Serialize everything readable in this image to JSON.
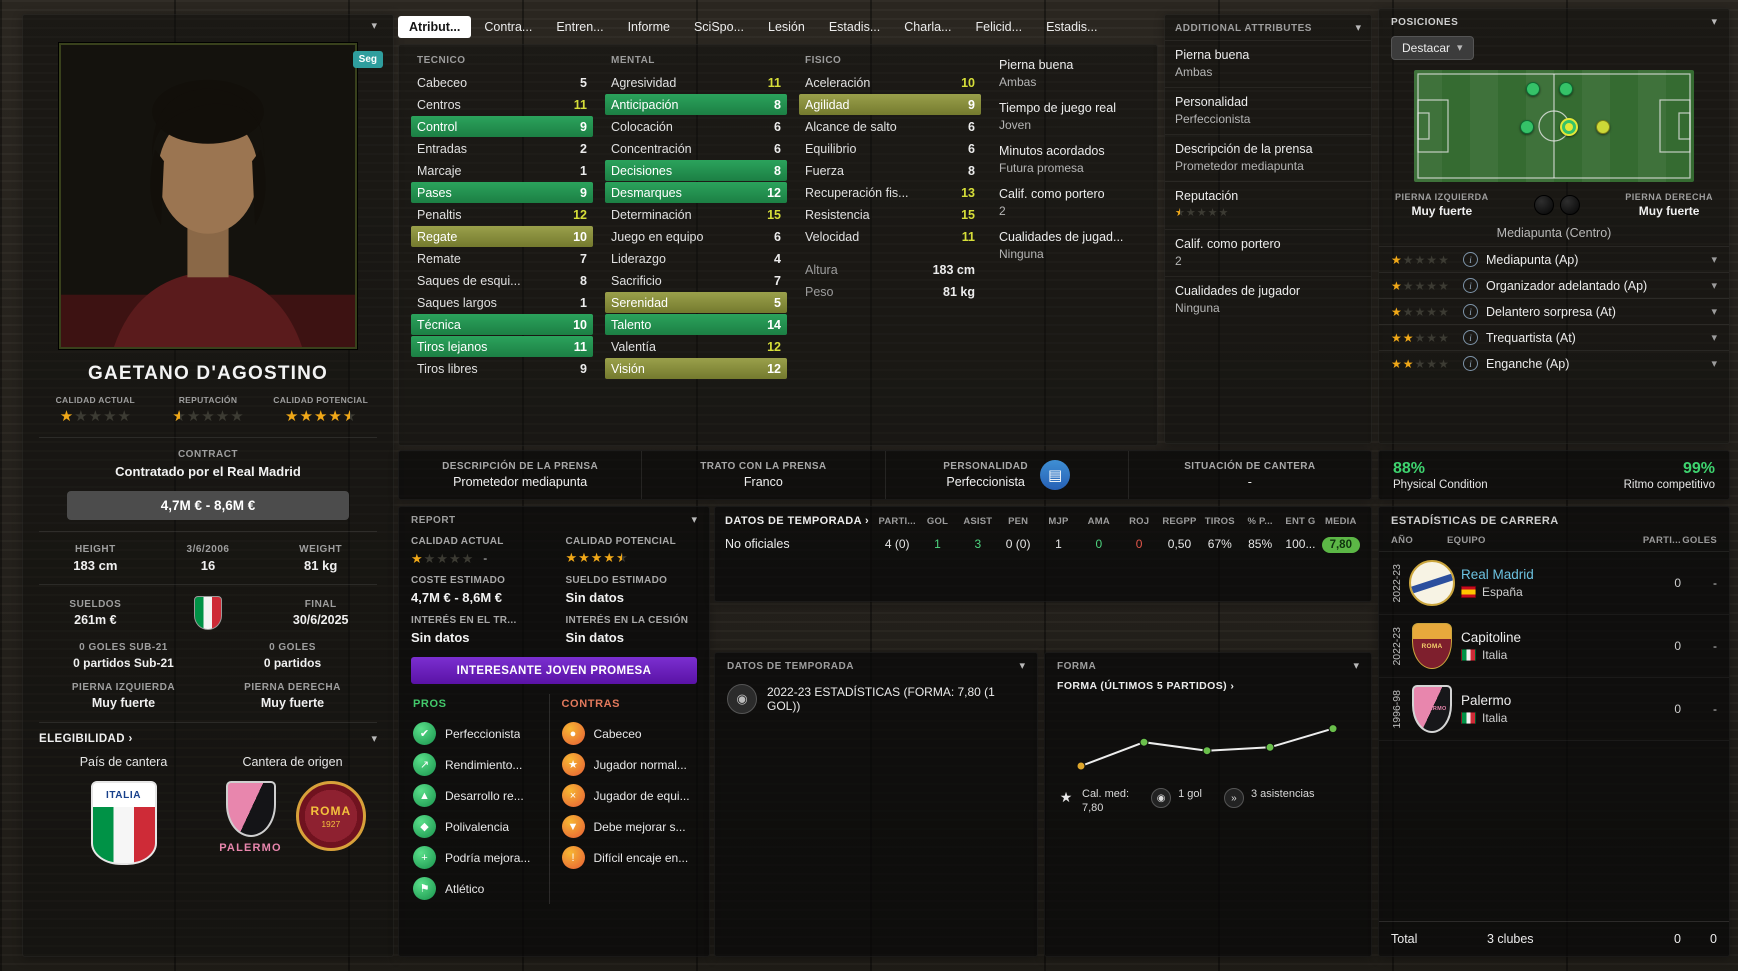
{
  "icons": {
    "chevron_down": "▾",
    "link_arrow": "›",
    "info": "i",
    "device": "▤",
    "badge": "◉"
  },
  "left_panel": {
    "follow_button": "Seg",
    "name": "GAETANO D'AGOSTINO",
    "ratings": [
      {
        "label": "CALIDAD ACTUAL",
        "stars": 1
      },
      {
        "label": "REPUTACIÓN",
        "stars": 0.5
      },
      {
        "label": "CALIDAD POTENCIAL",
        "stars": 4.5
      }
    ],
    "contract_label": "CONTRACT",
    "contract_text": "Contratado por el Real Madrid",
    "value_range": "4,7M € - 8,6M €",
    "vitals": [
      {
        "label": "HEIGHT",
        "value": "183 cm"
      },
      {
        "label": "3/6/2006",
        "value": "16"
      },
      {
        "label": "WEIGHT",
        "value": "81 kg"
      }
    ],
    "wage_label": "SUELDOS",
    "wage": "261m €",
    "expiry_label": "FINAL",
    "expiry": "30/6/2025",
    "u21_goals_label": "0 GOLES SUB-21",
    "u21_apps": "0 partidos Sub-21",
    "intl_goals_label": "0 GOLES",
    "intl_apps": "0 partidos",
    "left_foot_label": "PIERNA IZQUIERDA",
    "left_foot": "Muy fuerte",
    "right_foot_label": "PIERNA DERECHA",
    "right_foot": "Muy fuerte",
    "eligibility_label": "ELEGIBILIDAD ›",
    "nation_label": "País de cantera",
    "origin_label": "Cantera de origen",
    "italia_badge_text": "ITALIA",
    "palermo_badge_text": "PALERMO",
    "roma_badge_text": "ROMA",
    "roma_badge_year": "1927"
  },
  "tabs": [
    {
      "label": "Atribut...",
      "state": "active"
    },
    {
      "label": "Contra...",
      "state": ""
    },
    {
      "label": "Entren...",
      "state": ""
    },
    {
      "label": "Informe",
      "state": ""
    },
    {
      "label": "SciSpo...",
      "state": ""
    },
    {
      "label": "Lesión",
      "state": ""
    },
    {
      "label": "Estadis...",
      "state": ""
    },
    {
      "label": "Charla...",
      "state": ""
    },
    {
      "label": "Felicid...",
      "state": ""
    },
    {
      "label": "Estadis...",
      "state": ""
    }
  ],
  "attributes": {
    "tecnico_header": "TECNICO",
    "mental_header": "MENTAL",
    "fisico_header": "FISICO",
    "tecnico": [
      {
        "label": "Cabeceo",
        "value": "5",
        "row": "",
        "tone": ""
      },
      {
        "label": "Centros",
        "value": "11",
        "row": "",
        "tone": "hi"
      },
      {
        "label": "Control",
        "value": "9",
        "row": "green",
        "tone": ""
      },
      {
        "label": "Entradas",
        "value": "2",
        "row": "",
        "tone": ""
      },
      {
        "label": "Marcaje",
        "value": "1",
        "row": "",
        "tone": ""
      },
      {
        "label": "Pases",
        "value": "9",
        "row": "green",
        "tone": ""
      },
      {
        "label": "Penaltis",
        "value": "12",
        "row": "",
        "tone": "hi"
      },
      {
        "label": "Regate",
        "value": "10",
        "row": "olive",
        "tone": "hi"
      },
      {
        "label": "Remate",
        "value": "7",
        "row": "",
        "tone": ""
      },
      {
        "label": "Saques de esqui...",
        "value": "8",
        "row": "",
        "tone": ""
      },
      {
        "label": "Saques largos",
        "value": "1",
        "row": "",
        "tone": ""
      },
      {
        "label": "Técnica",
        "value": "10",
        "row": "green",
        "tone": "hi"
      },
      {
        "label": "Tiros lejanos",
        "value": "11",
        "row": "green",
        "tone": "hi"
      },
      {
        "label": "Tiros libres",
        "value": "9",
        "row": "",
        "tone": ""
      }
    ],
    "mental": [
      {
        "label": "Agresividad",
        "value": "11",
        "row": "",
        "tone": "hi"
      },
      {
        "label": "Anticipación",
        "value": "8",
        "row": "green",
        "tone": ""
      },
      {
        "label": "Colocación",
        "value": "6",
        "row": "",
        "tone": ""
      },
      {
        "label": "Concentración",
        "value": "6",
        "row": "",
        "tone": ""
      },
      {
        "label": "Decisiones",
        "value": "8",
        "row": "green",
        "tone": ""
      },
      {
        "label": "Desmarques",
        "value": "12",
        "row": "green",
        "tone": "hi"
      },
      {
        "label": "Determinación",
        "value": "15",
        "row": "",
        "tone": "hi"
      },
      {
        "label": "Juego en equipo",
        "value": "6",
        "row": "",
        "tone": ""
      },
      {
        "label": "Liderazgo",
        "value": "4",
        "row": "",
        "tone": ""
      },
      {
        "label": "Sacrificio",
        "value": "7",
        "row": "",
        "tone": ""
      },
      {
        "label": "Serenidad",
        "value": "5",
        "row": "olive",
        "tone": ""
      },
      {
        "label": "Talento",
        "value": "14",
        "row": "green",
        "tone": "hi"
      },
      {
        "label": "Valentía",
        "value": "12",
        "row": "",
        "tone": "hi"
      },
      {
        "label": "Visión",
        "value": "12",
        "row": "olive",
        "tone": "hi"
      }
    ],
    "fisico": [
      {
        "label": "Aceleración",
        "value": "10",
        "row": "",
        "tone": "hi"
      },
      {
        "label": "Agilidad",
        "value": "9",
        "row": "olive",
        "tone": ""
      },
      {
        "label": "Alcance de salto",
        "value": "6",
        "row": "",
        "tone": ""
      },
      {
        "label": "Equilibrio",
        "value": "6",
        "row": "",
        "tone": ""
      },
      {
        "label": "Fuerza",
        "value": "8",
        "row": "",
        "tone": ""
      },
      {
        "label": "Recuperación fis...",
        "value": "13",
        "row": "",
        "tone": "hi"
      },
      {
        "label": "Resistencia",
        "value": "15",
        "row": "",
        "tone": "hi"
      },
      {
        "label": "Velocidad",
        "value": "11",
        "row": "",
        "tone": "hi"
      }
    ],
    "fisico_extra": [
      {
        "label": "Altura",
        "value": "183 cm",
        "row": "meta",
        "tone": ""
      },
      {
        "label": "Peso",
        "value": "81 kg",
        "row": "meta",
        "tone": ""
      }
    ],
    "side_info": [
      {
        "label": "Pierna buena",
        "value": "Ambas"
      },
      {
        "label": "Tiempo de juego real",
        "value": "Joven"
      },
      {
        "label": "Minutos acordados",
        "value": "Futura promesa"
      },
      {
        "label": "Calif. como portero",
        "value": "2"
      },
      {
        "label": "Cualidades de jugad...",
        "value": "Ninguna"
      }
    ]
  },
  "additional_attributes": {
    "title": "ADDITIONAL ATTRIBUTES",
    "rows": [
      {
        "label": "Pierna buena",
        "value": "Ambas"
      },
      {
        "label": "Personalidad",
        "value": "Perfeccionista"
      },
      {
        "label": "Descripción de la prensa",
        "value": "Prometedor mediapunta"
      },
      {
        "label": "Reputación",
        "stars": 0.5
      },
      {
        "label": "Calif. como portero",
        "value": "2"
      },
      {
        "label": "Cualidades de jugador",
        "value": "Ninguna"
      }
    ]
  },
  "positions": {
    "title": "POSICIONES",
    "highlight_button": "Destacar",
    "dots": [
      {
        "x": "42%",
        "y": "16%",
        "type": "green"
      },
      {
        "x": "54%",
        "y": "16%",
        "type": "green"
      },
      {
        "x": "40%",
        "y": "50%",
        "type": "green"
      },
      {
        "x": "55%",
        "y": "50%",
        "type": "selected"
      },
      {
        "x": "67%",
        "y": "50%",
        "type": "accent"
      }
    ],
    "left_foot_label": "PIERNA IZQUIERDA",
    "left_foot": "Muy fuerte",
    "right_foot_label": "PIERNA DERECHA",
    "right_foot": "Muy fuerte",
    "natural_position": "Mediapunta (Centro)",
    "roles": [
      {
        "stars": 1,
        "label": "Mediapunta (Ap)"
      },
      {
        "stars": 1,
        "label": "Organizador adelantado (Ap)"
      },
      {
        "stars": 1,
        "label": "Delantero sorpresa (At)"
      },
      {
        "stars": 2,
        "label": "Trequartista (At)"
      },
      {
        "stars": 2,
        "label": "Enganche (Ap)"
      }
    ]
  },
  "condition": {
    "physical_value": "88%",
    "physical_label": "Physical Condition",
    "sharpness_value": "99%",
    "sharpness_label": "Ritmo competitivo"
  },
  "press": {
    "cells": [
      {
        "label": "DESCRIPCIÓN DE LA PRENSA",
        "value": "Prometedor mediapunta"
      },
      {
        "label": "TRATO CON LA PRENSA",
        "value": "Franco"
      },
      {
        "label": "PERSONALIDAD",
        "value": "Perfeccionista"
      },
      {
        "label": "SITUACIÓN DE CANTERA",
        "value": "-"
      }
    ]
  },
  "report": {
    "title": "REPORT",
    "current_label": "CALIDAD ACTUAL",
    "current_stars": 1,
    "current_extra": "-",
    "potential_label": "CALIDAD POTENCIAL",
    "potential_stars": 4.5,
    "cost_label": "COSTE ESTIMADO",
    "cost": "4,7M € - 8,6M €",
    "wage_label": "SUELDO ESTIMADO",
    "wage": "Sin datos",
    "transfer_label": "INTERÉS EN EL TR...",
    "transfer": "Sin datos",
    "loan_label": "INTERÉS EN LA CESIÓN",
    "loan": "Sin datos",
    "banner": "INTERESANTE JOVEN PROMESA",
    "pros_label": "PROS",
    "cons_label": "CONTRAS",
    "pros": [
      {
        "glyph": "✔",
        "label": "Perfeccionista"
      },
      {
        "glyph": "↗",
        "label": "Rendimiento..."
      },
      {
        "glyph": "▲",
        "label": "Desarrollo re..."
      },
      {
        "glyph": "◆",
        "label": "Polivalencia"
      },
      {
        "glyph": "+",
        "label": "Podría mejora..."
      },
      {
        "glyph": "⚑",
        "label": "Atlético"
      }
    ],
    "cons": [
      {
        "glyph": "●",
        "label": "Cabeceo"
      },
      {
        "glyph": "★",
        "label": "Jugador normal..."
      },
      {
        "glyph": "×",
        "label": "Jugador de equi..."
      },
      {
        "glyph": "▼",
        "label": "Debe mejorar s..."
      },
      {
        "glyph": "!",
        "label": "Difícil encaje en..."
      }
    ]
  },
  "season_table": {
    "title": "DATOS DE TEMPORADA ›",
    "row_label": "No oficiales",
    "columns": [
      {
        "header": "PARTI...",
        "value": "4 (0)",
        "tone": ""
      },
      {
        "header": "GOL",
        "value": "1",
        "tone": "green"
      },
      {
        "header": "ASIST",
        "value": "3",
        "tone": "green"
      },
      {
        "header": "PEN",
        "value": "0 (0)",
        "tone": ""
      },
      {
        "header": "MJP",
        "value": "1",
        "tone": ""
      },
      {
        "header": "AMA",
        "value": "0",
        "tone": "green"
      },
      {
        "header": "ROJ",
        "value": "0",
        "tone": "red"
      },
      {
        "header": "REGPP",
        "value": "0,50",
        "tone": ""
      },
      {
        "header": "TIROS",
        "value": "67%",
        "tone": ""
      },
      {
        "header": "% P...",
        "value": "85%",
        "tone": ""
      },
      {
        "header": "ENT G",
        "value": "100...",
        "tone": ""
      },
      {
        "header": "MEDIA",
        "value": "7,80",
        "tone": "badge"
      }
    ]
  },
  "season_overview": {
    "title": "DATOS DE TEMPORADA",
    "entry": "2022-23 ESTADÍSTICAS (FORMA: 7,80 (1 GOL))"
  },
  "forma": {
    "title": "FORMA",
    "subtitle": "FORMA (ÚLTIMOS 5 PARTIDOS) ›",
    "points": [
      {
        "x": 8,
        "y": 40,
        "c": "#dda62c"
      },
      {
        "x": 29,
        "y": 26,
        "c": "#6abf4b"
      },
      {
        "x": 50,
        "y": 31,
        "c": "#6abf4b"
      },
      {
        "x": 71,
        "y": 29,
        "c": "#6abf4b"
      },
      {
        "x": 92,
        "y": 18,
        "c": "#6abf4b"
      }
    ],
    "legend": [
      {
        "glyph": "★",
        "iconcls": "plain",
        "label": "Cal. med:",
        "value": "7,80"
      },
      {
        "glyph": "◉",
        "iconcls": "",
        "label": "1 gol",
        "value": ""
      },
      {
        "glyph": "»",
        "iconcls": "",
        "label": "3 asistencias",
        "value": ""
      }
    ]
  },
  "career": {
    "title": "ESTADÍSTICAS DE CARRERA",
    "col_year": "AÑO",
    "col_team": "EQUIPO",
    "col_apps": "PARTI...",
    "col_goals": "GOLES",
    "rows": [
      {
        "year": "2022-23",
        "team": "Real Madrid",
        "linkcls": "link",
        "crest": "realmadrid",
        "cresttext": "",
        "country": "España",
        "flagcls": "es",
        "apps": "0",
        "goals": "-"
      },
      {
        "year": "2022-23",
        "team": "Capitoline",
        "linkcls": "",
        "crest": "capitoline",
        "cresttext": "ROMA",
        "country": "Italia",
        "flagcls": "it",
        "apps": "0",
        "goals": "-"
      },
      {
        "year": "1996-98",
        "team": "Palermo",
        "linkcls": "",
        "crest": "palermo",
        "cresttext": "PALERMO",
        "country": "Italia",
        "flagcls": "it",
        "apps": "0",
        "goals": "-"
      }
    ],
    "total_label": "Total",
    "total_teams": "3 clubes",
    "total_apps": "0",
    "total_goals": "0"
  }
}
